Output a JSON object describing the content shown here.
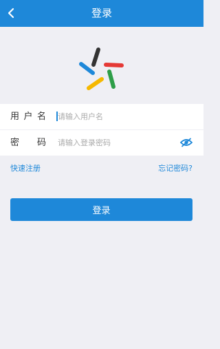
{
  "header": {
    "title": "登录",
    "back_icon": "chevron-left-icon"
  },
  "logo": {
    "icon": "star-logo-icon",
    "colors": [
      "#333333",
      "#e53935",
      "#2e9e48",
      "#f5b800",
      "#1e88d9"
    ]
  },
  "form": {
    "username": {
      "label_chars": [
        "用",
        "户",
        "名"
      ],
      "value": "",
      "placeholder": "请输入用户名"
    },
    "password": {
      "label_chars": [
        "密",
        "码"
      ],
      "value": "",
      "placeholder": "请输入登录密码",
      "toggle_icon": "eye-off-icon"
    }
  },
  "links": {
    "register": "快速注册",
    "forgot": "忘记密码?"
  },
  "actions": {
    "login_label": "登录"
  },
  "colors": {
    "accent": "#1e88d9",
    "background": "#efeff4"
  }
}
